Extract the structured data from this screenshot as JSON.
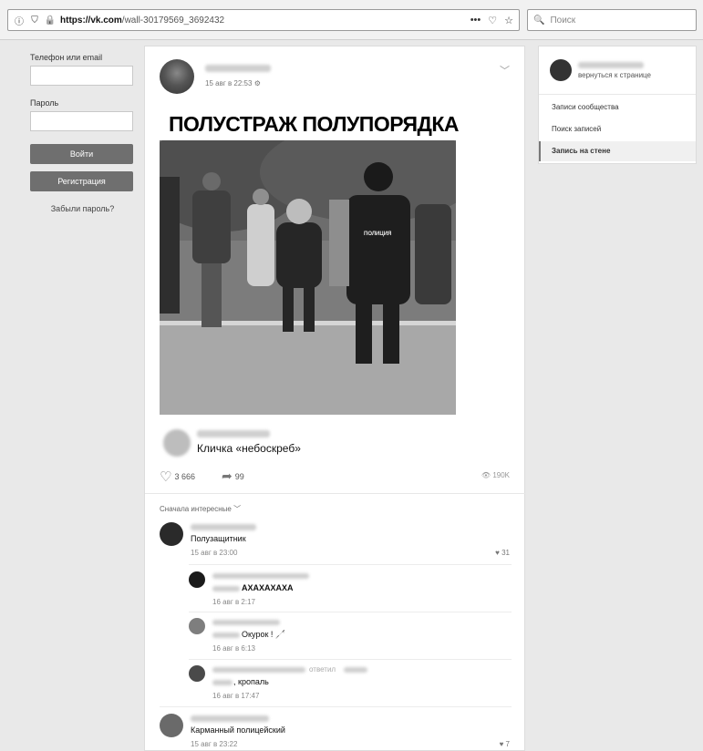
{
  "browser": {
    "url_domain": "https://vk.com",
    "url_path": "/wall-30179569_3692432",
    "search_placeholder": "Поиск",
    "more_glyph": "•••"
  },
  "login": {
    "phone_label": "Телефон или email",
    "password_label": "Пароль",
    "login_button": "Войти",
    "register_button": "Регистрация",
    "forgot_link": "Забыли пароль?"
  },
  "post": {
    "date": "15 авг в 22:53",
    "title": "ПОЛУСТРАЖ ПОЛУПОРЯДКА",
    "photo_badge": "ПОЛИЦИЯ",
    "caption": "Кличка «небоскреб»",
    "likes": "3 666",
    "shares": "99",
    "views": "190K",
    "sort_label": "Сначала интересные"
  },
  "comments": [
    {
      "text": "Полузащитник",
      "date": "15 авг в 23:00",
      "likes": "31"
    },
    {
      "text": "АХАХАХАХА",
      "date": "16 авг в 2:17"
    },
    {
      "text": "Окурок ! 🦯",
      "date": "16 авг в 6:13"
    },
    {
      "text": ", кропаль",
      "date": "16 авг в 17:47",
      "replied": "ответил"
    },
    {
      "text": "Карманный полицейский",
      "date": "15 авг в 23:22",
      "likes": "7"
    }
  ],
  "right_panel": {
    "back_label": "вернуться к странице",
    "nav": [
      {
        "label": "Записи сообщества"
      },
      {
        "label": "Поиск записей"
      },
      {
        "label": "Запись на стене"
      }
    ]
  },
  "colors": {
    "accent_gray": "#6f6f6f"
  }
}
